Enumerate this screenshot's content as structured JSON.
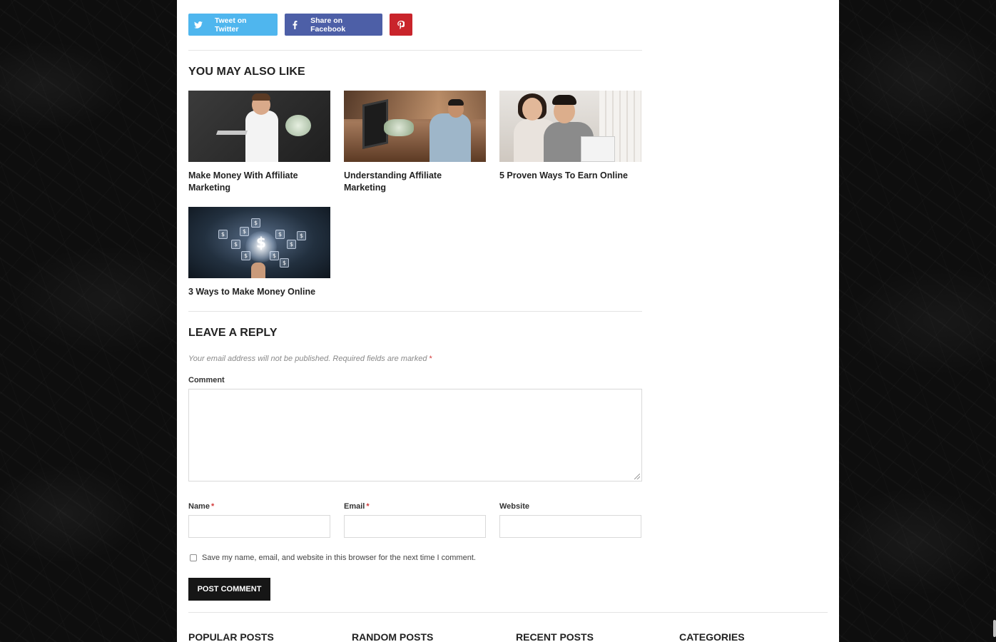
{
  "share": {
    "twitter_label": "Tweet on Twitter",
    "facebook_label": "Share on Facebook"
  },
  "related": {
    "title": "YOU MAY ALSO LIKE",
    "posts": [
      {
        "title": "Make Money With Affiliate Marketing"
      },
      {
        "title": "Understanding Affiliate Marketing"
      },
      {
        "title": "5 Proven Ways To Earn Online"
      },
      {
        "title": "3 Ways to Make Money Online"
      }
    ]
  },
  "reply": {
    "title": "LEAVE A REPLY",
    "note": "Your email address will not be published. Required fields are marked",
    "required_mark": "*",
    "comment_label": "Comment",
    "comment_value": "",
    "name_label": "Name",
    "email_label": "Email",
    "website_label": "Website",
    "name_value": "",
    "email_value": "",
    "website_value": "",
    "consent_label": "Save my name, email, and website in this browser for the next time I comment.",
    "submit_label": "POST COMMENT"
  },
  "footer": {
    "widgets": [
      "POPULAR POSTS",
      "RANDOM POSTS",
      "RECENT POSTS",
      "CATEGORIES"
    ]
  },
  "colors": {
    "twitter": "#4fb6ee",
    "facebook": "#4d5fa7",
    "pinterest": "#c9242b",
    "button_dark": "#161616",
    "required": "#d23a3a"
  },
  "icons": [
    "twitter-icon",
    "facebook-icon",
    "pinterest-icon"
  ]
}
